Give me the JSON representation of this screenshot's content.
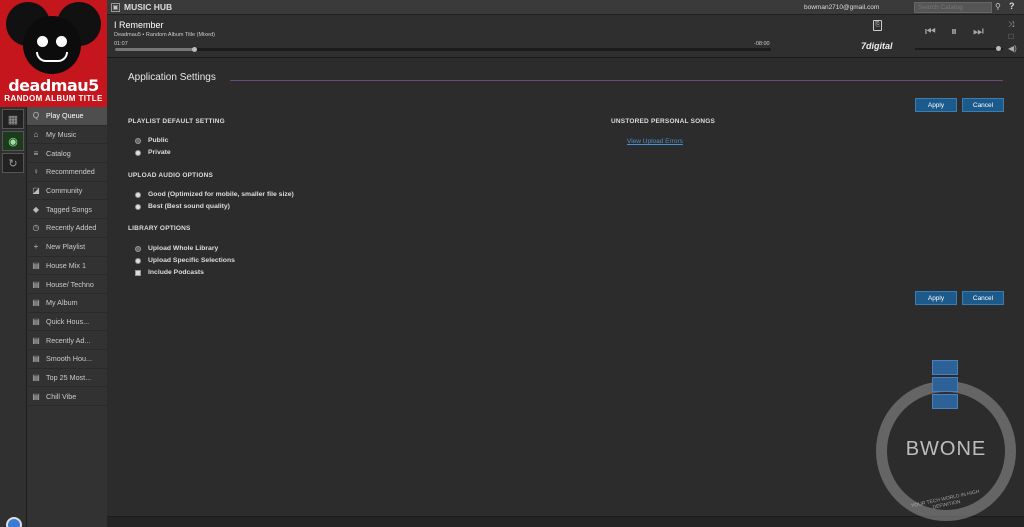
{
  "album": {
    "artist_logo": "deadmau5",
    "subtitle": "RANDOM ALBUM TITLE"
  },
  "topbar": {
    "brand": "MUSIC HUB",
    "user_email": "bowman2710@gmail.com",
    "search_placeholder": "Search Catalog",
    "help": "?"
  },
  "player": {
    "track_title": "I Remember",
    "track_meta": "Deadmau5  •  Random Album Title (Mixed)",
    "elapsed": "01:07",
    "remaining": "-08:00",
    "progress": 0.12,
    "volume": 0.95,
    "store_logo": "7digital"
  },
  "sidebar": {
    "items": [
      {
        "label": "Play Queue",
        "icon": "queue-icon",
        "glyph": "Q"
      },
      {
        "label": "My Music",
        "icon": "home-icon",
        "glyph": "⌂"
      },
      {
        "label": "Catalog",
        "icon": "catalog-icon",
        "glyph": "≡"
      },
      {
        "label": "Recommended",
        "icon": "pin-icon",
        "glyph": "♀"
      },
      {
        "label": "Community",
        "icon": "community-icon",
        "glyph": "◪"
      },
      {
        "label": "Tagged Songs",
        "icon": "tag-icon",
        "glyph": "◆"
      },
      {
        "label": "Recently Added",
        "icon": "clock-icon",
        "glyph": "◷"
      },
      {
        "label": "New Playlist",
        "icon": "plus-icon",
        "glyph": "+"
      },
      {
        "label": "House Mix 1",
        "icon": "playlist-icon",
        "glyph": "▤"
      },
      {
        "label": "House/ Techno",
        "icon": "playlist-icon",
        "glyph": "▤"
      },
      {
        "label": "My Album",
        "icon": "playlist-icon",
        "glyph": "▤"
      },
      {
        "label": "Quick Hous...",
        "icon": "playlist-icon",
        "glyph": "▤"
      },
      {
        "label": "Recently Ad...",
        "icon": "playlist-icon",
        "glyph": "▤"
      },
      {
        "label": "Smooth Hou...",
        "icon": "playlist-icon",
        "glyph": "▤"
      },
      {
        "label": "Top 25 Most...",
        "icon": "playlist-icon",
        "glyph": "▤"
      },
      {
        "label": "Chill Vibe",
        "icon": "playlist-icon",
        "glyph": "▤"
      }
    ]
  },
  "main": {
    "title": "Application Settings",
    "apply_label": "Apply",
    "cancel_label": "Cancel",
    "playlist_default": {
      "heading": "PLAYLIST DEFAULT SETTING",
      "options": [
        {
          "label": "Public",
          "selected": true
        },
        {
          "label": "Private",
          "selected": false
        }
      ]
    },
    "upload_audio": {
      "heading": "UPLOAD AUDIO OPTIONS",
      "options": [
        {
          "label": "Good (Optimized for mobile, smaller file size)",
          "selected": false
        },
        {
          "label": "Best (Best sound quality)",
          "selected": false
        }
      ]
    },
    "library": {
      "heading": "LIBRARY OPTIONS",
      "options": [
        {
          "label": "Upload Whole Library",
          "selected": true
        },
        {
          "label": "Upload Specific Selections",
          "selected": false
        }
      ],
      "podcasts_label": "Include Podcasts",
      "podcasts_checked": false
    },
    "unstored": {
      "heading": "UNSTORED PERSONAL SONGS",
      "link": "View Upload Errors"
    }
  },
  "watermark": {
    "text": "BWONE",
    "slogan": "YOUR TECH WORLD IN HIGH DEFINITION"
  },
  "colors": {
    "accent": "#1c5a8c",
    "album_red": "#c4161c",
    "link": "#4a8fd0"
  }
}
